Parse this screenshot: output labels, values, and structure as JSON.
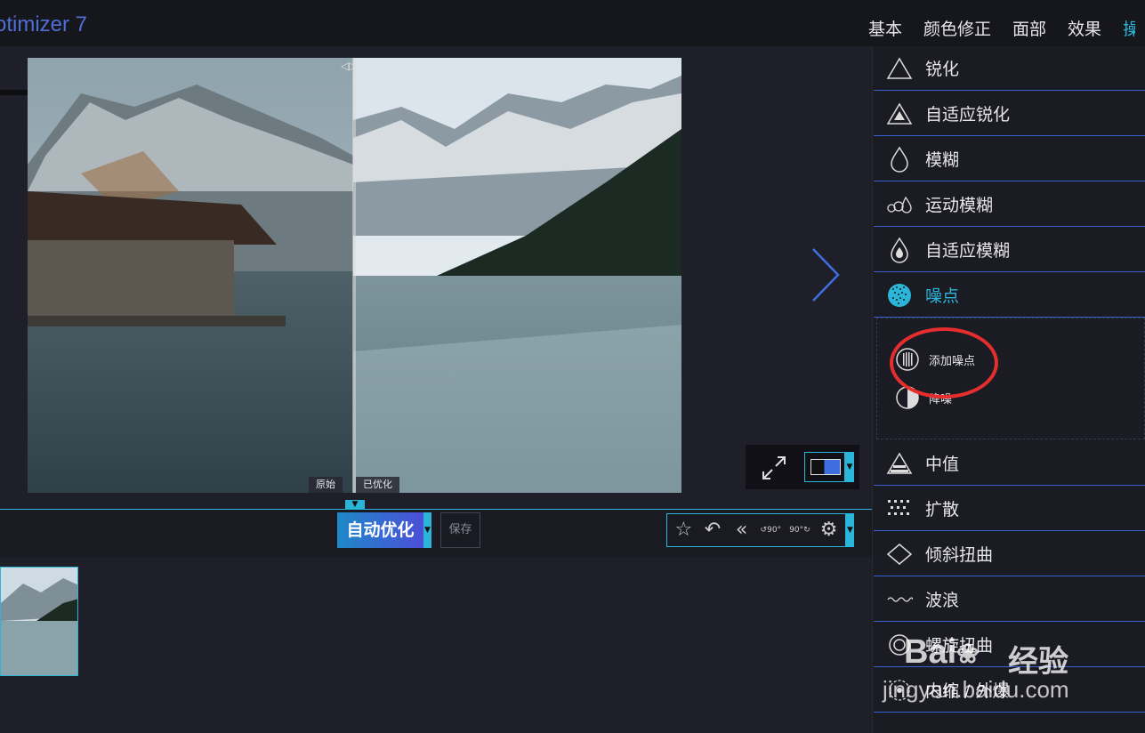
{
  "app": {
    "title": "otimizer 7"
  },
  "tabs": [
    "基本",
    "颜色修正",
    "面部",
    "效果",
    "操"
  ],
  "compare": {
    "original_label": "原始",
    "optimized_label": "已优化"
  },
  "actions": {
    "auto_label": "自动优化",
    "save_label": "保存"
  },
  "toolbar_icons": [
    "favorites-star-icon",
    "undo-icon",
    "undo-all-icon",
    "rotate-left-90-icon",
    "rotate-right-90-icon",
    "settings-gear-icon"
  ],
  "rotate_label": "90°",
  "effects": [
    {
      "label": "锐化",
      "icon": "sharpen-triangle-icon"
    },
    {
      "label": "自适应锐化",
      "icon": "adaptive-sharpen-icon"
    },
    {
      "label": "模糊",
      "icon": "blur-drop-icon"
    },
    {
      "label": "运动模糊",
      "icon": "motion-blur-icon"
    },
    {
      "label": "自适应模糊",
      "icon": "adaptive-blur-icon"
    },
    {
      "label": "噪点",
      "icon": "noise-icon",
      "active": true
    },
    {
      "label": "中值",
      "icon": "median-icon"
    },
    {
      "label": "扩散",
      "icon": "diffuse-icon"
    },
    {
      "label": "倾斜扭曲",
      "icon": "skew-icon"
    },
    {
      "label": "波浪",
      "icon": "wave-icon"
    },
    {
      "label": "螺旋扭曲",
      "icon": "swirl-icon"
    },
    {
      "label": "内缩 / 外爆",
      "icon": "pinch-icon"
    }
  ],
  "noise_options": [
    {
      "label": "添加噪点",
      "icon": "add-noise-icon"
    },
    {
      "label": "降噪",
      "icon": "reduce-noise-icon"
    }
  ],
  "watermark": {
    "brand": "Bai",
    "brand_cn": "经验",
    "url": "jingyan.baidu.com"
  },
  "colors": {
    "accent": "#2bb6d9",
    "panel_line": "#3b5fd0",
    "highlight": "#e62e2e"
  }
}
